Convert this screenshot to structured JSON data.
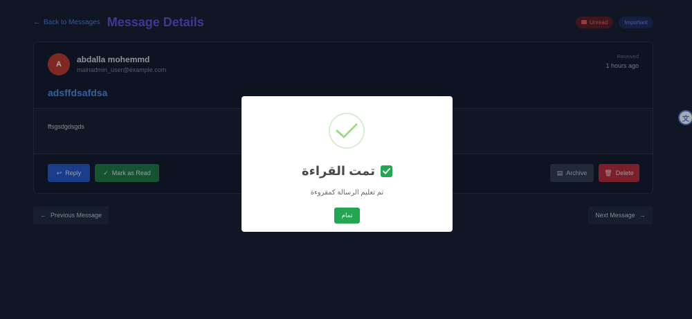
{
  "header": {
    "back_label": "Back to Messages",
    "title": "Message Details",
    "badges": {
      "unread": "Unread",
      "important": "Important"
    }
  },
  "message": {
    "avatar_initial": "A",
    "sender_name": "abdalla mohemmd",
    "sender_email": "mainadmin_user@example.com",
    "received_label": "Received",
    "received_time": "1 hours ago",
    "subject": "adsffdsafdsa",
    "body": "ffsgsdgdsgds"
  },
  "actions": {
    "reply": "Reply",
    "mark_as_read": "Mark as Read",
    "archive": "Archive",
    "delete": "Delete"
  },
  "navigation": {
    "previous": "Previous Message",
    "next": "Next Message"
  },
  "modal": {
    "title": "تمت القراءة",
    "text": "تم تعليم الرسالة كمقروءة",
    "button": "تمام"
  },
  "colors": {
    "background": "#161c2d",
    "title": "#5b4fd6",
    "subject": "#4c8fe0",
    "success": "#22a652",
    "danger": "#b92a35",
    "primary": "#2356c9"
  },
  "icons": {
    "back": "arrow-left-icon",
    "unread": "envelope-icon",
    "reply": "reply-icon",
    "mark": "check-icon",
    "archive": "archive-icon",
    "delete": "trash-icon",
    "prev": "arrow-left-icon",
    "next": "arrow-right-icon",
    "modal": "success-check-icon",
    "title": "checkbox-checked-icon",
    "side": "translate-widget-icon"
  }
}
